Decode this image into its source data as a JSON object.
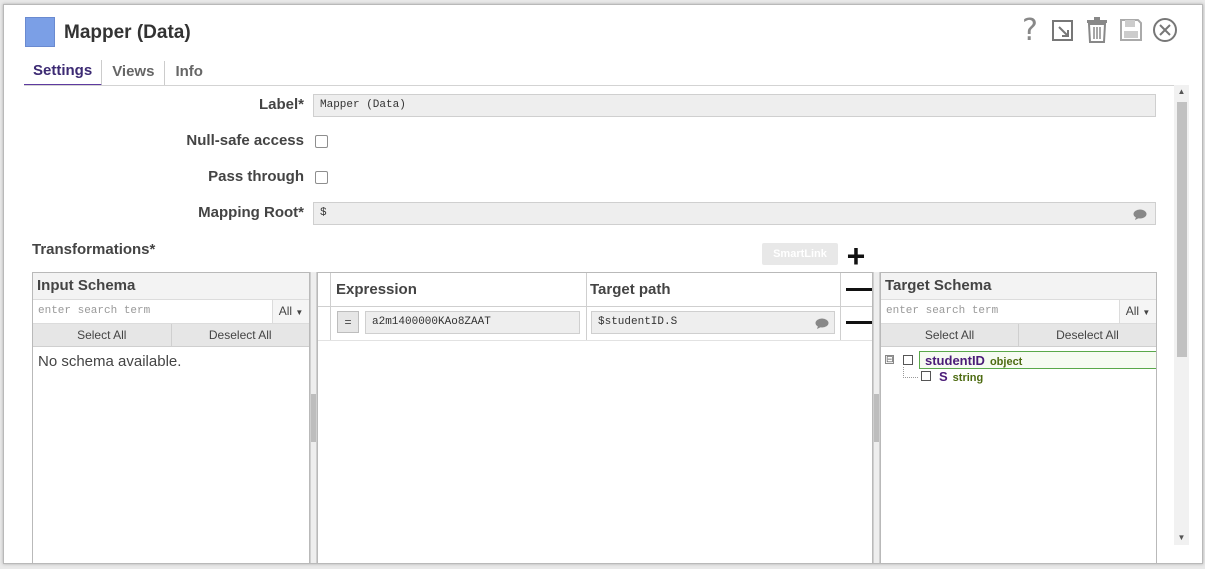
{
  "dialog": {
    "title": "Mapper (Data)",
    "swatch_color": "#7b9fe6",
    "header_icons": [
      "help-icon",
      "export-icon",
      "trash-icon",
      "save-icon",
      "close-icon"
    ]
  },
  "tabs": [
    {
      "label": "Settings",
      "active": true
    },
    {
      "label": "Views",
      "active": false
    },
    {
      "label": "Info",
      "active": false
    }
  ],
  "form": {
    "label_label": "Label*",
    "label_value": "Mapper (Data)",
    "null_safe_label": "Null-safe access",
    "null_safe_checked": false,
    "pass_through_label": "Pass through",
    "pass_through_checked": false,
    "mapping_root_label": "Mapping Root*",
    "mapping_root_value": "$"
  },
  "transformations": {
    "title": "Transformations*",
    "smartlink_label": "SmartLink",
    "add_symbol": "+"
  },
  "input_schema": {
    "title": "Input Schema",
    "search_placeholder": "enter search term",
    "filter_value": "All",
    "select_all": "Select All",
    "deselect_all": "Deselect All",
    "empty_message": "No schema available."
  },
  "mapping_table": {
    "col_expression": "Expression",
    "col_target": "Target path",
    "rows": [
      {
        "operator": "=",
        "expression": "a2m1400000KAo8ZAAT",
        "target": "$studentID.S"
      }
    ]
  },
  "target_schema": {
    "title": "Target Schema",
    "search_placeholder": "enter search term",
    "filter_value": "All",
    "select_all": "Select All",
    "deselect_all": "Deselect All",
    "nodes": [
      {
        "name": "studentID",
        "type": "object",
        "expander": "⊟"
      },
      {
        "name": "S",
        "type": "string"
      }
    ]
  }
}
